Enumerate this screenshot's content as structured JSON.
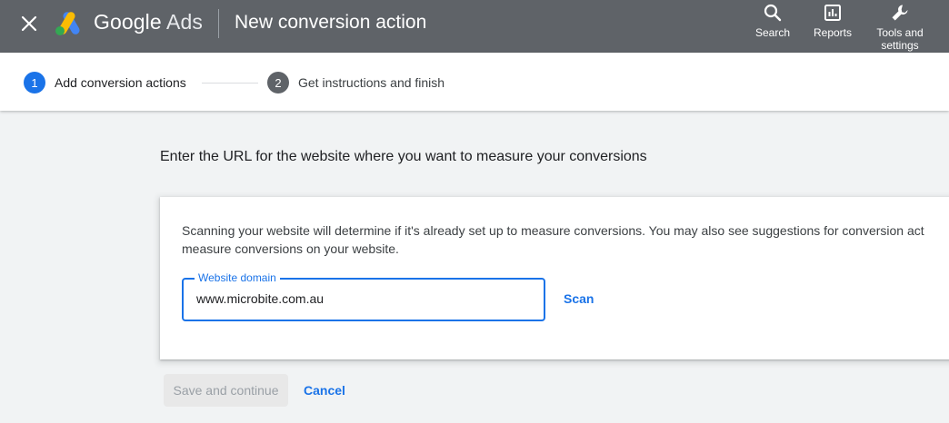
{
  "header": {
    "brand_google": "Google",
    "brand_ads": "Ads",
    "title": "New conversion action",
    "tools": [
      {
        "label": "Search",
        "icon": "search-icon"
      },
      {
        "label": "Reports",
        "icon": "reports-icon"
      },
      {
        "label": "Tools and\nsettings",
        "icon": "wrench-icon"
      }
    ]
  },
  "stepper": {
    "steps": [
      {
        "number": "1",
        "label": "Add conversion actions",
        "active": true
      },
      {
        "number": "2",
        "label": "Get instructions and finish",
        "active": false
      }
    ]
  },
  "main": {
    "heading": "Enter the URL for the website where you want to measure your conversions",
    "card": {
      "description_line1": "Scanning your website will determine if it's already set up to measure conversions. You may also see suggestions for conversion act",
      "description_line2": "measure conversions on your website.",
      "field_label": "Website domain",
      "field_value": "www.microbite.com.au",
      "scan_label": "Scan"
    },
    "actions": {
      "save_label": "Save and continue",
      "cancel_label": "Cancel"
    }
  },
  "colors": {
    "header_bg": "#5f6368",
    "accent": "#1a73e8",
    "page_bg": "#f1f3f4"
  }
}
